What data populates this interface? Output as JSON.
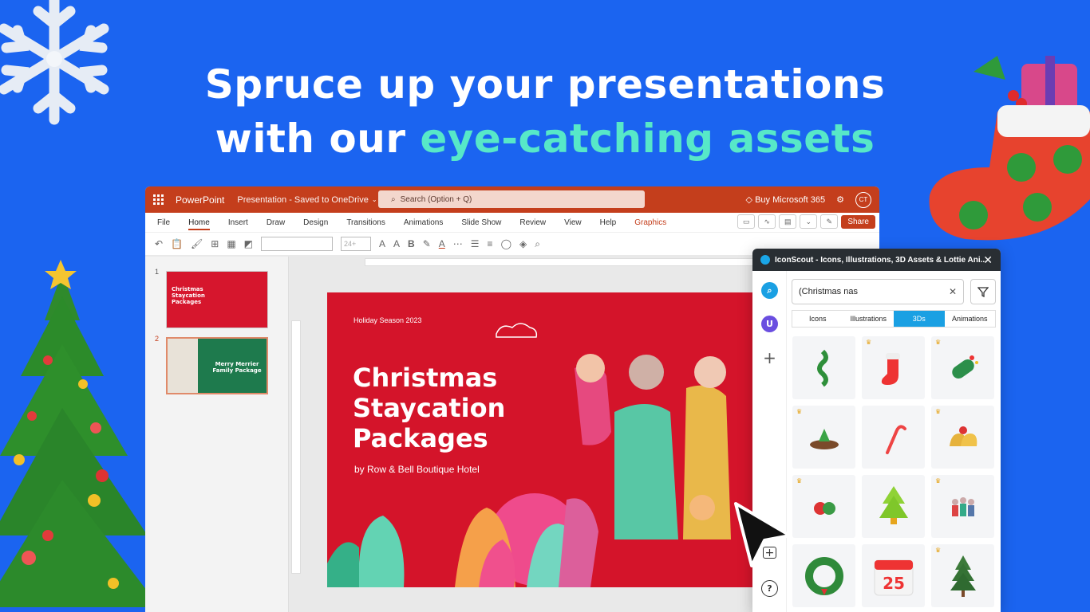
{
  "headline": {
    "line1": "Spruce up your presentations",
    "line2_prefix": "with our ",
    "line2_accent": "eye-catching assets"
  },
  "powerpoint": {
    "app_name": "PowerPoint",
    "doc_name": "Presentation - Saved to OneDrive",
    "search_placeholder": "Search (Option + Q)",
    "buy_label": "Buy Microsoft 365",
    "avatar_initials": "CT",
    "menu": [
      "File",
      "Home",
      "Insert",
      "Draw",
      "Design",
      "Transitions",
      "Animations",
      "Slide Show",
      "Review",
      "View",
      "Help",
      "Graphics"
    ],
    "active_menu": "Home",
    "share_label": "Share",
    "font_size_placeholder": "24+",
    "slide_numbers": [
      "1",
      "2"
    ],
    "thumb1_text": "Christmas Staycation Packages",
    "thumb2_text": "Merry Merrier Family Package",
    "slide": {
      "subtitle": "Holiday Season 2023",
      "title": "Christmas Staycation Packages",
      "byline": "by Row & Bell Boutique Hotel"
    }
  },
  "iconscout": {
    "panel_title": "IconScout - Icons, Illustrations, 3D Assets & Lottie Ani...",
    "avatar_letter": "U",
    "search_value": "(Christmas nas",
    "tabs": [
      "Icons",
      "Illustrations",
      "3Ds",
      "Animations"
    ],
    "active_tab": "3Ds",
    "results": [
      "ribbon",
      "stocking",
      "candy-wrap",
      "cake",
      "candy-cane",
      "bells",
      "ornaments",
      "tree",
      "carolers",
      "wreath",
      "calendar-25",
      "pine-tree"
    ]
  },
  "colors": {
    "background": "#1b64f0",
    "accent_text": "#57e8c8",
    "ppt_brand": "#c43e1c",
    "slide_red": "#d4142a",
    "iconscout_blue": "#1aa0e3"
  }
}
